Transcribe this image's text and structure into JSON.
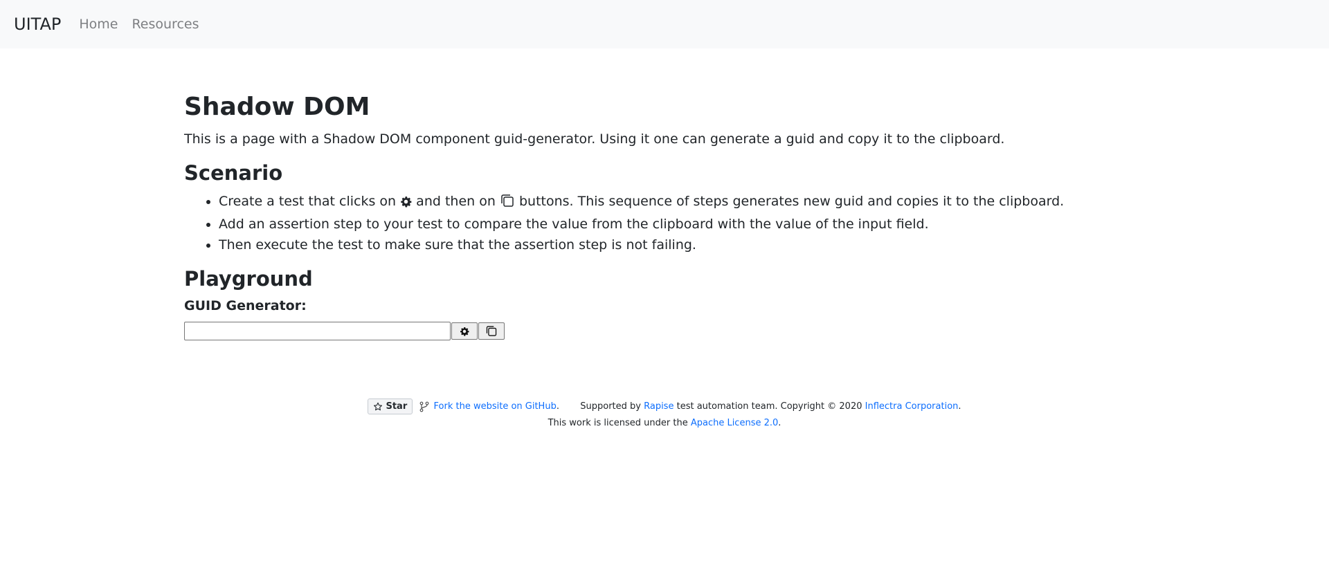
{
  "navbar": {
    "brand": "UITAP",
    "links": [
      "Home",
      "Resources"
    ]
  },
  "main": {
    "title": "Shadow DOM",
    "description": "This is a page with a Shadow DOM component guid-generator. Using it one can generate a guid and copy it to the clipboard.",
    "scenario": {
      "heading": "Scenario",
      "step1": {
        "before": "Create a test that clicks on",
        "middle": "and then on",
        "after": "buttons. This sequence of steps generates new guid and copies it to the clipboard."
      },
      "step2": "Add an assertion step to your test to compare the value from the clipboard with the value of the input field.",
      "step3": "Then execute the test to make sure that the assertion step is not failing."
    },
    "playground": {
      "heading": "Playground",
      "label": "GUID Generator:",
      "input_value": ""
    }
  },
  "footer": {
    "star_label": "Star",
    "fork_link": "Fork the website on GitHub",
    "supported_by": "Supported by",
    "rapise_link": "Rapise",
    "team_text": "test automation team. Copyright © 2020",
    "inflectra_link": "Inflectra Corporation",
    "license_text": "This work is licensed under the",
    "license_link": "Apache License 2.0"
  },
  "icons": {
    "generate": "gear-icon",
    "copy": "copy-icon",
    "star": "star-icon",
    "fork": "fork-icon"
  },
  "colors": {
    "navbar_bg": "#f8f9fa",
    "link": "#0d6efd",
    "text": "#212529"
  }
}
